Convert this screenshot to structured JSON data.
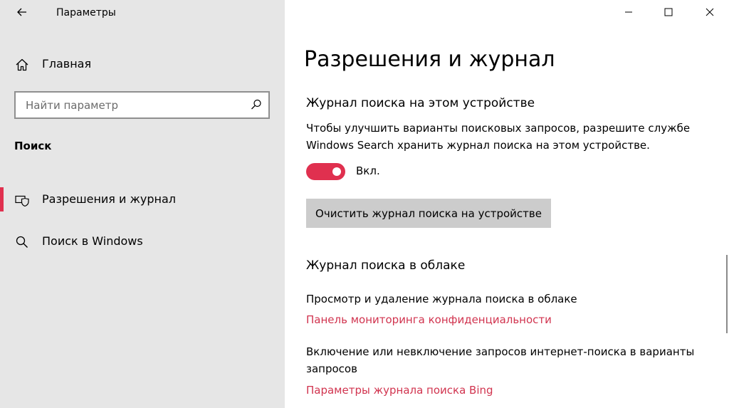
{
  "app": {
    "title": "Параметры"
  },
  "sidebar": {
    "home_label": "Главная",
    "search": {
      "placeholder": "Найти параметр"
    },
    "section_title": "Поиск",
    "items": [
      {
        "label": "Разрешения и журнал",
        "icon": "shield-icon",
        "selected": true
      },
      {
        "label": "Поиск в Windows",
        "icon": "search-icon",
        "selected": false
      }
    ]
  },
  "main": {
    "title": "Разрешения и журнал",
    "device_history": {
      "heading": "Журнал поиска на этом устройстве",
      "description": "Чтобы улучшить варианты поисковых запросов, разрешите службе Windows Search хранить журнал поиска на этом устройстве.",
      "toggle": {
        "state": "on",
        "label": "Вкл."
      },
      "clear_button": "Очистить журнал поиска на устройстве"
    },
    "cloud_history": {
      "heading": "Журнал поиска в облаке",
      "view_text": "Просмотр и удаление журнала поиска в облаке",
      "privacy_link": "Панель мониторинга конфиденциальности",
      "bing_text": "Включение или невключение запросов интернет-поиска в варианты запросов",
      "bing_link": "Параметры журнала поиска Bing"
    }
  },
  "colors": {
    "accent": "#e0304f",
    "link": "#d1344f",
    "sidebar_bg": "#e6e6e6",
    "button_bg": "#cccccc"
  }
}
